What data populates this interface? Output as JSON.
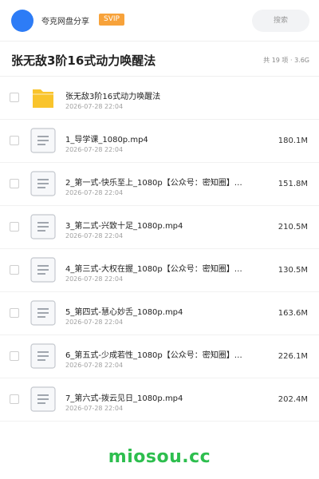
{
  "header": {
    "brand": "夸克网盘分享",
    "badge": "SVIP",
    "search_placeholder": "搜索"
  },
  "folder": {
    "title": "张无敌3阶16式动力唤醒法",
    "summary": "共 19 项 · 3.6G"
  },
  "items": [
    {
      "type": "folder",
      "name": "张无敌3阶16式动力唤醒法",
      "date": "2026-07-28 22:04",
      "size": ""
    },
    {
      "type": "file",
      "name": "1_导学课_1080p.mp4",
      "date": "2026-07-28 22:04",
      "size": "180.1M"
    },
    {
      "type": "file",
      "name": "2_第一式-快乐至上_1080p【公众号：密知圈】…",
      "date": "2026-07-28 22:04",
      "size": "151.8M"
    },
    {
      "type": "file",
      "name": "3_第二式-兴致十足_1080p.mp4",
      "date": "2026-07-28 22:04",
      "size": "210.5M"
    },
    {
      "type": "file",
      "name": "4_第三式-大权在握_1080p【公众号：密知圈】…",
      "date": "2026-07-28 22:04",
      "size": "130.5M"
    },
    {
      "type": "file",
      "name": "5_第四式-慧心妙舌_1080p.mp4",
      "date": "2026-07-28 22:04",
      "size": "163.6M"
    },
    {
      "type": "file",
      "name": "6_第五式-少成若性_1080p【公众号：密知圈】…",
      "date": "2026-07-28 22:04",
      "size": "226.1M"
    },
    {
      "type": "file",
      "name": "7_第六式-拨云见日_1080p.mp4",
      "date": "2026-07-28 22:04",
      "size": "202.4M"
    }
  ],
  "colors": {
    "accent": "#2d7cf6",
    "badge": "#f7a23a",
    "folder": "#f9c42c",
    "watermark": "#2dbe4e"
  },
  "icons": {
    "folder": "folder-icon",
    "file": "video-file-icon"
  },
  "watermark": "miosou.cc"
}
